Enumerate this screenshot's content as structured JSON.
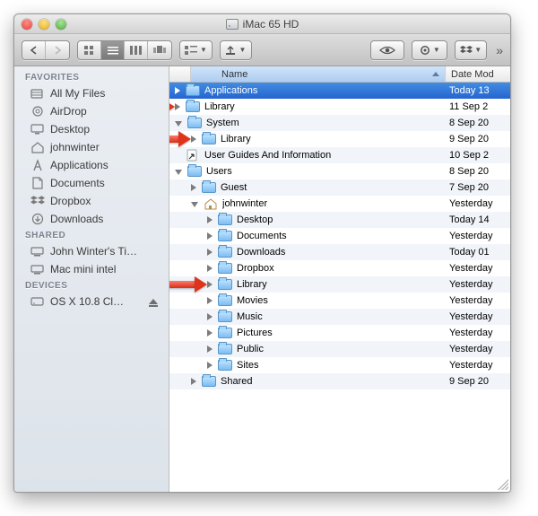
{
  "window": {
    "title": "iMac 65 HD"
  },
  "columns": {
    "name": "Name",
    "date": "Date Mod"
  },
  "sidebar": {
    "sections": [
      {
        "header": "FAVORITES",
        "items": [
          {
            "label": "All My Files",
            "icon": "all-my-files-icon"
          },
          {
            "label": "AirDrop",
            "icon": "airdrop-icon"
          },
          {
            "label": "Desktop",
            "icon": "desktop-icon"
          },
          {
            "label": "johnwinter",
            "icon": "home-icon"
          },
          {
            "label": "Applications",
            "icon": "applications-icon"
          },
          {
            "label": "Documents",
            "icon": "documents-icon"
          },
          {
            "label": "Dropbox",
            "icon": "dropbox-icon"
          },
          {
            "label": "Downloads",
            "icon": "downloads-icon"
          }
        ]
      },
      {
        "header": "SHARED",
        "items": [
          {
            "label": "John Winter's Ti…",
            "icon": "shared-computer-icon"
          },
          {
            "label": "Mac mini intel",
            "icon": "shared-computer-icon"
          }
        ]
      },
      {
        "header": "DEVICES",
        "items": [
          {
            "label": "OS X 10.8 Cl…",
            "icon": "disk-icon",
            "eject": true
          }
        ]
      }
    ]
  },
  "rows": [
    {
      "indent": 0,
      "disclosure": "closed",
      "icon": "folder-apps",
      "name": "Applications",
      "date": "Today 13",
      "selected": true,
      "arrow": false
    },
    {
      "indent": 0,
      "disclosure": "closed",
      "icon": "folder-lib",
      "name": "Library",
      "date": "11 Sep 2",
      "selected": false,
      "arrow": true
    },
    {
      "indent": 0,
      "disclosure": "open",
      "icon": "folder-sys",
      "name": "System",
      "date": "8 Sep 20",
      "selected": false,
      "arrow": false
    },
    {
      "indent": 1,
      "disclosure": "closed",
      "icon": "folder",
      "name": "Library",
      "date": "9 Sep 20",
      "selected": false,
      "arrow": true
    },
    {
      "indent": 0,
      "disclosure": "none",
      "icon": "alias",
      "name": "User Guides And Information",
      "date": "10 Sep 2",
      "selected": false,
      "arrow": false
    },
    {
      "indent": 0,
      "disclosure": "open",
      "icon": "folder-users",
      "name": "Users",
      "date": "8 Sep 20",
      "selected": false,
      "arrow": false
    },
    {
      "indent": 1,
      "disclosure": "closed",
      "icon": "folder",
      "name": "Guest",
      "date": "7 Sep 20",
      "selected": false,
      "arrow": false
    },
    {
      "indent": 1,
      "disclosure": "open",
      "icon": "home",
      "name": "johnwinter",
      "date": "Yesterday",
      "selected": false,
      "arrow": false
    },
    {
      "indent": 2,
      "disclosure": "closed",
      "icon": "folder-desk",
      "name": "Desktop",
      "date": "Today 14",
      "selected": false,
      "arrow": false
    },
    {
      "indent": 2,
      "disclosure": "closed",
      "icon": "folder-docs",
      "name": "Documents",
      "date": "Yesterday",
      "selected": false,
      "arrow": false
    },
    {
      "indent": 2,
      "disclosure": "closed",
      "icon": "folder-down",
      "name": "Downloads",
      "date": "Today 01",
      "selected": false,
      "arrow": false
    },
    {
      "indent": 2,
      "disclosure": "closed",
      "icon": "folder-dbx",
      "name": "Dropbox",
      "date": "Yesterday",
      "selected": false,
      "arrow": false
    },
    {
      "indent": 2,
      "disclosure": "closed",
      "icon": "folder-lib",
      "name": "Library",
      "date": "Yesterday",
      "selected": false,
      "arrow": true
    },
    {
      "indent": 2,
      "disclosure": "closed",
      "icon": "folder-mov",
      "name": "Movies",
      "date": "Yesterday",
      "selected": false,
      "arrow": false
    },
    {
      "indent": 2,
      "disclosure": "closed",
      "icon": "folder-mus",
      "name": "Music",
      "date": "Yesterday",
      "selected": false,
      "arrow": false
    },
    {
      "indent": 2,
      "disclosure": "closed",
      "icon": "folder-pic",
      "name": "Pictures",
      "date": "Yesterday",
      "selected": false,
      "arrow": false
    },
    {
      "indent": 2,
      "disclosure": "closed",
      "icon": "folder-pub",
      "name": "Public",
      "date": "Yesterday",
      "selected": false,
      "arrow": false
    },
    {
      "indent": 2,
      "disclosure": "closed",
      "icon": "folder-sites",
      "name": "Sites",
      "date": "Yesterday",
      "selected": false,
      "arrow": false
    },
    {
      "indent": 1,
      "disclosure": "closed",
      "icon": "folder",
      "name": "Shared",
      "date": "9 Sep 20",
      "selected": false,
      "arrow": false
    }
  ]
}
